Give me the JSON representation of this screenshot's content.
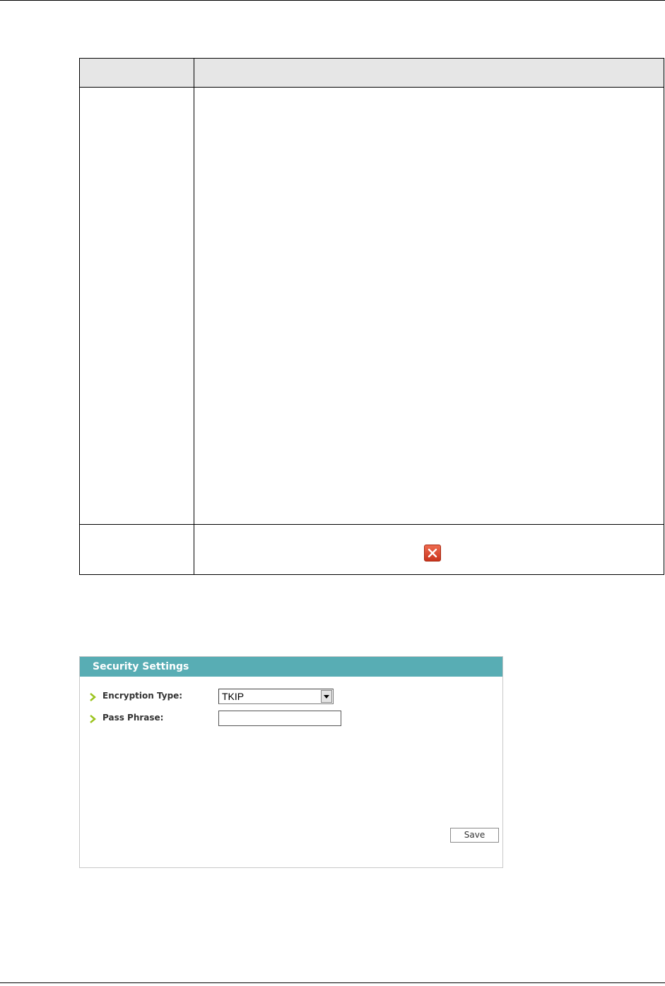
{
  "panel": {
    "title": "Security Settings",
    "fields": [
      {
        "label": "Encryption Type:",
        "value": "TKIP",
        "type": "select"
      },
      {
        "label": "Pass Phrase:",
        "value": "",
        "type": "text"
      }
    ],
    "save_label": "Save"
  },
  "colors": {
    "header": "#58adb4",
    "arrow": "#9bc41f",
    "close_icon": "#d9452b"
  },
  "icons": {
    "close": "close-icon",
    "bullet": "chevron-right-icon",
    "dropdown": "chevron-down-icon"
  }
}
